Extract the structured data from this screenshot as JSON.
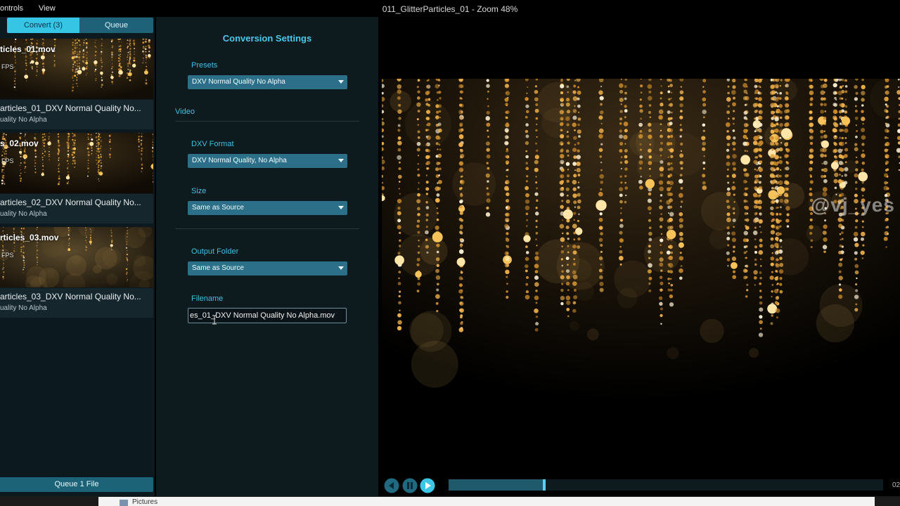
{
  "menu": {
    "controls": "ontrols",
    "view": "View",
    "window_title": "011_GlitterParticles_01 - Zoom 48%"
  },
  "tabs": {
    "convert": "Convert (3)",
    "queue": "Queue"
  },
  "items": [
    {
      "name": "ticles_01.mov",
      "fps": "FPS",
      "output_name": "articles_01_DXV Normal Quality No...",
      "output_sub": "uality No Alpha"
    },
    {
      "name": "s_02.mov",
      "fps": "FPS",
      "output_name": "articles_02_DXV Normal Quality No...",
      "output_sub": "uality No Alpha"
    },
    {
      "name": "rticles_03.mov",
      "fps": "FPS",
      "output_name": "articles_03_DXV Normal Quality No...",
      "output_sub": "uality No Alpha"
    }
  ],
  "queue_button": "Queue 1 File",
  "settings": {
    "heading": "Conversion Settings",
    "presets_label": "Presets",
    "presets_value": "DXV Normal Quality No Alpha",
    "video_section": "Video",
    "dxv_format_label": "DXV Format",
    "dxv_format_value": "DXV Normal Quality, No Alpha",
    "size_label": "Size",
    "size_value": "Same as Source",
    "output_folder_label": "Output Folder",
    "output_folder_value": "Same as Source",
    "filename_label": "Filename",
    "filename_value": "es_01_DXV Normal Quality No Alpha.mov"
  },
  "watermark": "@vj_yes",
  "transport": {
    "timecode": "02",
    "progress": 0.22
  },
  "taskbar": {
    "label": "Pictures"
  },
  "colors": {
    "accent": "#36c5e4",
    "panel": "#0d1b1f",
    "select": "#2b7088"
  }
}
